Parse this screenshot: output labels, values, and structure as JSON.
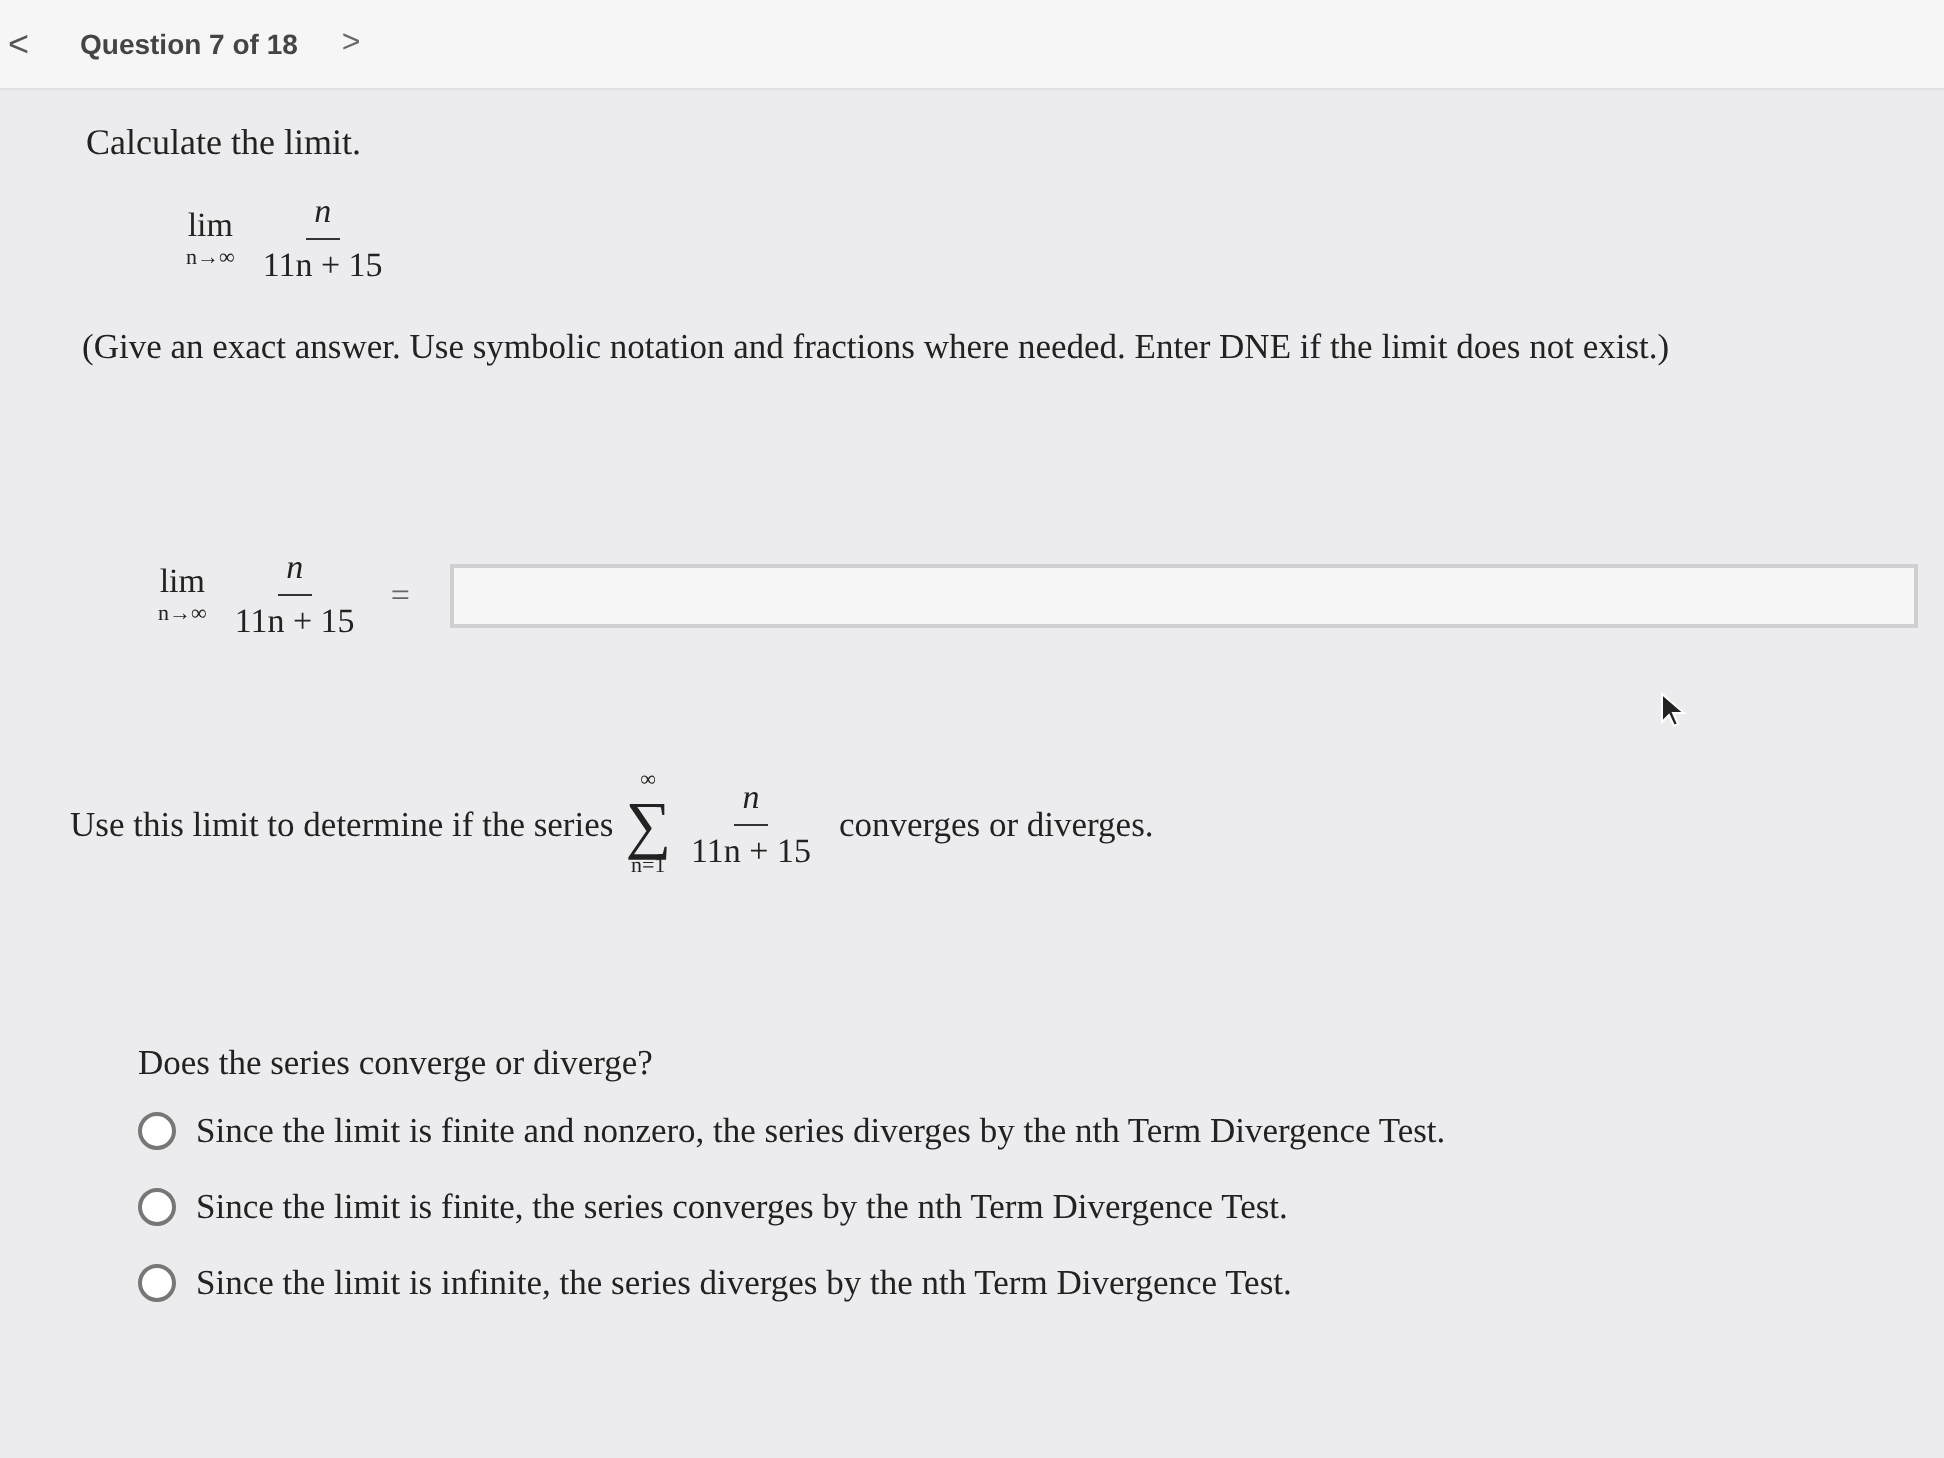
{
  "header": {
    "back": "<",
    "title": "Question 7 of 18",
    "next": ">"
  },
  "prompt": "Calculate the limit.",
  "expression": {
    "lim": "lim",
    "sub": "n→∞",
    "numerator": "n",
    "denominator": "11n + 15"
  },
  "instructions": "(Give an exact answer. Use symbolic notation and fractions where needed. Enter DNE if the limit does not exist.)",
  "answer": {
    "lim": "lim",
    "sub": "n→∞",
    "numerator": "n",
    "denominator": "11n + 15",
    "equals": "="
  },
  "series_question": {
    "before": "Use this limit to determine if the series",
    "sum": "∑",
    "upper": "∞",
    "lower": "n=1",
    "numerator": "n",
    "denominator": "11n + 15",
    "after": "converges or diverges."
  },
  "question": "Does the series converge or diverge?",
  "options": [
    {
      "label": "Since the limit is finite and nonzero, the series diverges by the nth Term Divergence Test.",
      "selected": false
    },
    {
      "label": "Since the limit is finite, the series converges by the nth Term Divergence Test.",
      "selected": false
    },
    {
      "label": "Since the limit is infinite, the series diverges by the nth Term Divergence Test.",
      "selected": false
    }
  ]
}
